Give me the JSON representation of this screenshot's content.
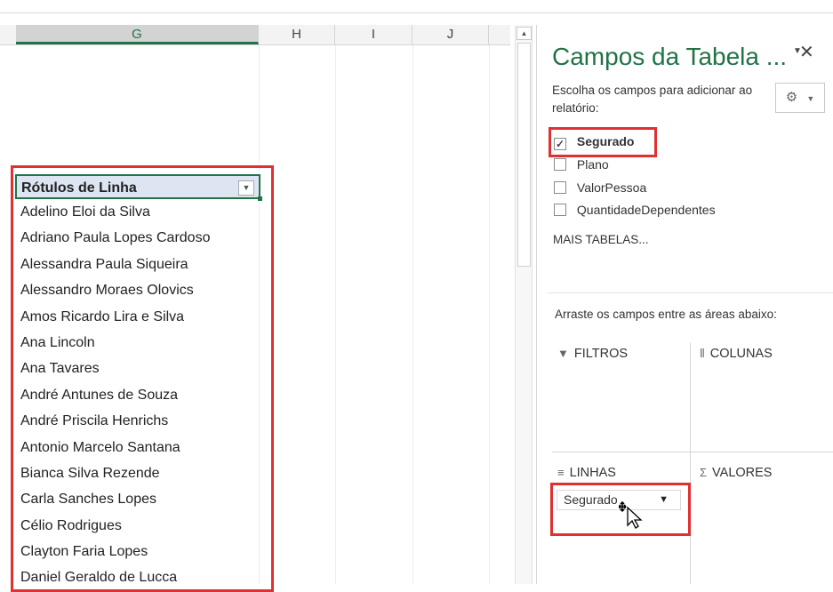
{
  "sheet": {
    "columns": [
      "G",
      "H",
      "I",
      "J"
    ],
    "selected_column": "G"
  },
  "pivot": {
    "header": "Rótulos de Linha",
    "rows": [
      "Adelino Eloi da Silva",
      "Adriano Paula Lopes Cardoso",
      "Alessandra Paula Siqueira",
      "Alessandro Moraes Olovics",
      "Amos Ricardo Lira e Silva",
      "Ana Lincoln",
      "Ana Tavares",
      "André Antunes de Souza",
      "André Priscila Henrichs",
      "Antonio Marcelo Santana",
      "Bianca Silva Rezende",
      "Carla Sanches Lopes",
      "Célio Rodrigues",
      "Clayton Faria Lopes",
      "Daniel Geraldo de Lucca"
    ]
  },
  "pane": {
    "title": "Campos da Tabela ...",
    "subtitle": "Escolha os campos para adicionar ao relatório:",
    "fields": [
      {
        "label": "Segurado",
        "checked": true
      },
      {
        "label": "Plano",
        "checked": false
      },
      {
        "label": "ValorPessoa",
        "checked": false
      },
      {
        "label": "QuantidadeDependentes",
        "checked": false
      }
    ],
    "more_tables": "MAIS TABELAS...",
    "drag_hint": "Arraste os campos entre as áreas abaixo:",
    "areas": {
      "filters": "FILTROS",
      "columns": "COLUNAS",
      "rows": "LINHAS",
      "values": "VALORES"
    },
    "rows_chip": "Segurado"
  },
  "icons": {
    "check": "✓",
    "dropdown": "▼",
    "close": "✕",
    "gear": "⚙",
    "filter": "▼",
    "columns_glyph": "⦀",
    "rows_glyph": "≡",
    "sigma": "Σ"
  },
  "colors": {
    "accent_green": "#217346",
    "highlight_red": "#e03030",
    "pivot_header_bg": "#dde4f2"
  }
}
